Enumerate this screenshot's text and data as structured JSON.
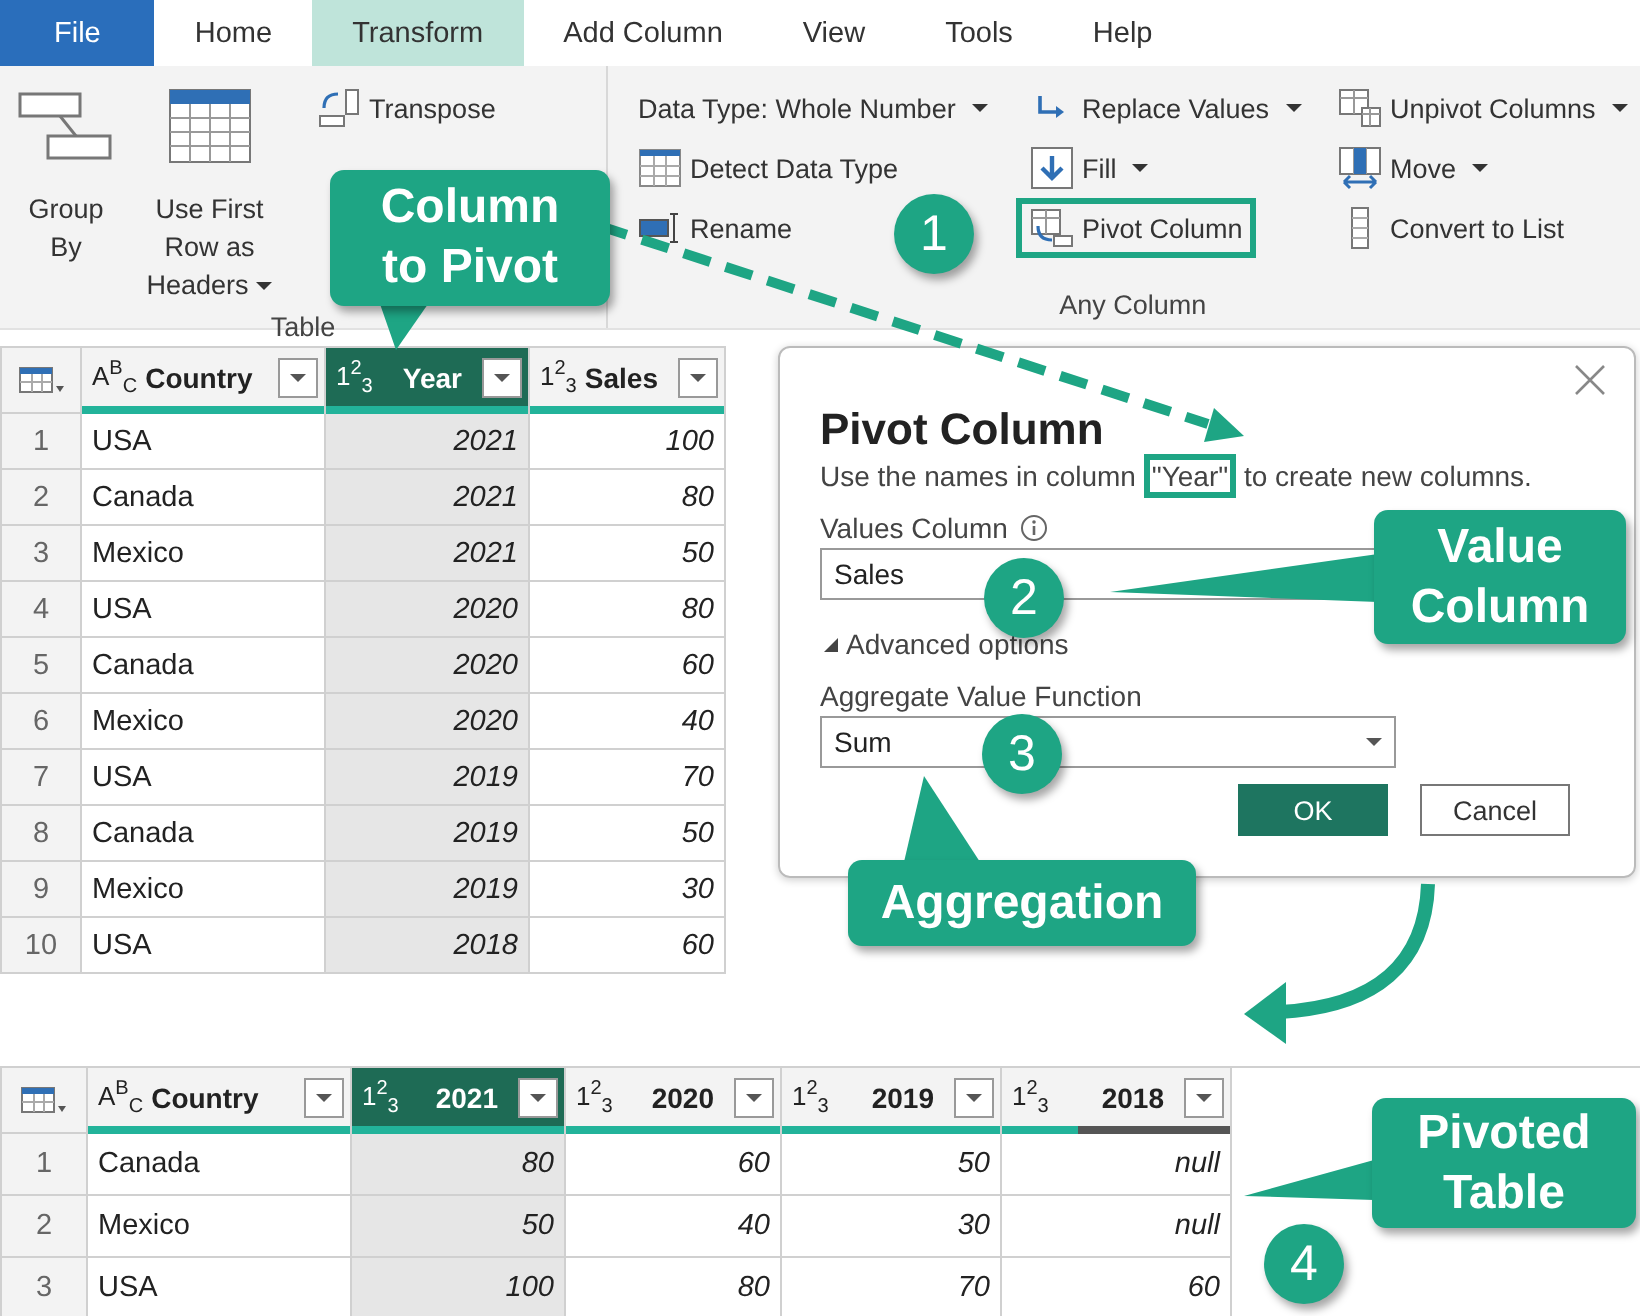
{
  "ribbon_tabs": [
    {
      "label": "File",
      "kind": "file",
      "selected": false
    },
    {
      "label": "Home",
      "kind": "tab",
      "selected": false
    },
    {
      "label": "Transform",
      "kind": "tab",
      "selected": true
    },
    {
      "label": "Add Column",
      "kind": "tab",
      "selected": false
    },
    {
      "label": "View",
      "kind": "tab",
      "selected": false
    },
    {
      "label": "Tools",
      "kind": "tab",
      "selected": false
    },
    {
      "label": "Help",
      "kind": "tab",
      "selected": false
    }
  ],
  "ribbon_groups": [
    {
      "label": "Table",
      "large_buttons": [
        {
          "label": "Group By",
          "dropdown": false
        },
        {
          "label": "Use First Row as Headers",
          "dropdown": true
        }
      ],
      "columns": [
        [
          {
            "label": "Transpose",
            "dropdown": false,
            "highlighted": false
          }
        ]
      ]
    },
    {
      "label": "Any Column",
      "columns": [
        [
          {
            "label": "Data Type: Whole Number",
            "dropdown": true,
            "highlighted": false
          },
          {
            "label": "Detect Data Type",
            "dropdown": false,
            "highlighted": false
          },
          {
            "label": "Rename",
            "dropdown": false,
            "highlighted": false
          }
        ],
        [
          {
            "label": "Replace Values",
            "dropdown": true,
            "highlighted": false
          },
          {
            "label": "Fill",
            "dropdown": true,
            "highlighted": false
          },
          {
            "label": "Pivot Column",
            "dropdown": false,
            "highlighted": true
          }
        ],
        [
          {
            "label": "Unpivot Columns",
            "dropdown": true,
            "highlighted": false
          },
          {
            "label": "Move",
            "dropdown": true,
            "highlighted": false
          },
          {
            "label": "Convert to List",
            "dropdown": false,
            "highlighted": false
          }
        ]
      ]
    }
  ],
  "source_table": {
    "columns": [
      {
        "type": "A$^{B}$$_{C}$",
        "name": "Country",
        "kind": "text",
        "selected": false,
        "level": 1
      },
      {
        "type": "1$^{2}$$_{3}$",
        "name": "Year",
        "kind": "number",
        "selected": true,
        "level": 1
      },
      {
        "type": "1$^{2}$$_{3}$",
        "name": "Sales",
        "kind": "number",
        "selected": false,
        "level": 1
      }
    ],
    "rows": [
      {
        "index": "1",
        "cells": [
          "USA",
          "2021",
          "100"
        ]
      },
      {
        "index": "2",
        "cells": [
          "Canada",
          "2021",
          "80"
        ]
      },
      {
        "index": "3",
        "cells": [
          "Mexico",
          "2021",
          "50"
        ]
      },
      {
        "index": "4",
        "cells": [
          "USA",
          "2020",
          "80"
        ]
      },
      {
        "index": "5",
        "cells": [
          "Canada",
          "2020",
          "60"
        ]
      },
      {
        "index": "6",
        "cells": [
          "Mexico",
          "2020",
          "40"
        ]
      },
      {
        "index": "7",
        "cells": [
          "USA",
          "2019",
          "70"
        ]
      },
      {
        "index": "8",
        "cells": [
          "Canada",
          "2019",
          "50"
        ]
      },
      {
        "index": "9",
        "cells": [
          "Mexico",
          "2019",
          "30"
        ]
      },
      {
        "index": "10",
        "cells": [
          "USA",
          "2018",
          "60"
        ]
      }
    ]
  },
  "dialog": {
    "title": "Pivot Column",
    "description": [
      {
        "text": "Use the names in column ",
        "highlighted": false
      },
      {
        "text": "\"Year\"",
        "highlighted": true
      },
      {
        "text": " to create new columns.",
        "highlighted": false
      }
    ],
    "values_column": {
      "label": "Values Column",
      "value": "Sales"
    },
    "advanced_options": {
      "label": "Advanced options",
      "expanded": true
    },
    "aggregate_function": {
      "label": "Aggregate Value Function",
      "value": "Sum"
    },
    "buttons": [
      {
        "label": "OK",
        "kind": "primary"
      },
      {
        "label": "Cancel",
        "kind": "secondary"
      }
    ]
  },
  "result_table": {
    "columns": [
      {
        "type": "A$^{B}$$_{C}$",
        "name": "Country",
        "kind": "text",
        "selected": false,
        "level": 1
      },
      {
        "type": "1$^{2}$$_{3}$",
        "name": "2021",
        "kind": "number",
        "selected": true,
        "level": 1
      },
      {
        "type": "1$^{2}$$_{3}$",
        "name": "2020",
        "kind": "number",
        "selected": false,
        "level": 1
      },
      {
        "type": "1$^{2}$$_{3}$",
        "name": "2019",
        "kind": "number",
        "selected": false,
        "level": 1
      },
      {
        "type": "1$^{2}$$_{3}$",
        "name": "2018",
        "kind": "number",
        "selected": false,
        "level": 0.33
      }
    ],
    "rows": [
      {
        "index": "1",
        "cells": [
          "Canada",
          "80",
          "60",
          "50",
          "null"
        ]
      },
      {
        "index": "2",
        "cells": [
          "Mexico",
          "50",
          "40",
          "30",
          "null"
        ]
      },
      {
        "index": "3",
        "cells": [
          "USA",
          "100",
          "80",
          "70",
          "60"
        ]
      }
    ]
  },
  "callouts": [
    "Column to Pivot",
    "Value Column",
    "Aggregation",
    "Pivoted Table"
  ],
  "step_badges": [
    "1",
    "2",
    "3",
    "4"
  ]
}
